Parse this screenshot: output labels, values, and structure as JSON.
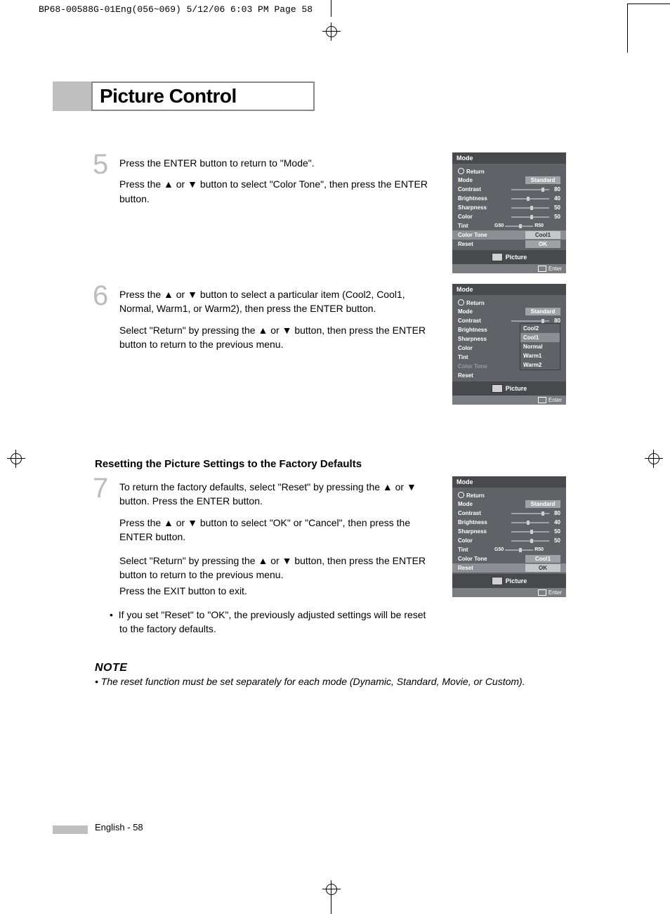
{
  "header_line": "BP68-00588G-01Eng(056~069)  5/12/06  6:03 PM  Page 58",
  "title": "Picture Control",
  "step5": {
    "num": "5",
    "p1": "Press the ENTER button to return to \"Mode\".",
    "p2": "Press the ▲ or ▼ button to select \"Color Tone\", then press the ENTER button."
  },
  "step6": {
    "num": "6",
    "p1": "Press the ▲ or ▼ button to select a particular item (Cool2, Cool1, Normal, Warm1, or Warm2), then press the ENTER button.",
    "p2": "Select \"Return\" by pressing the ▲ or ▼ button, then press the ENTER button to return to the previous menu."
  },
  "section_head": "Resetting the Picture Settings to the Factory Defaults",
  "step7": {
    "num": "7",
    "p1": "To return the factory defaults, select \"Reset\" by pressing the ▲ or ▼ button. Press the ENTER button.",
    "p2": "Press the ▲ or ▼ button to select \"OK\" or \"Cancel\", then press the ENTER button.",
    "p3": "Select \"Return\" by pressing the ▲ or ▼ button, then press the ENTER button to return to the previous menu.",
    "p4": "Press the EXIT button to exit.",
    "bullet": "If you set \"Reset\" to \"OK\", the previously adjusted settings will be reset to the factory defaults."
  },
  "note": {
    "head": "NOTE",
    "text": "•  The reset function must be set separately for each mode (Dynamic, Standard, Movie, or Custom)."
  },
  "footer": "English - 58",
  "osd": {
    "title": "Mode",
    "return": "Return",
    "mode_label": "Mode",
    "mode_val": "Standard",
    "contrast_label": "Contrast",
    "contrast_val": "80",
    "brightness_label": "Brightness",
    "brightness_val": "40",
    "sharpness_label": "Sharpness",
    "sharpness_val": "50",
    "color_label": "Color",
    "color_val": "50",
    "tint_label": "Tint",
    "tint_g": "G50",
    "tint_r": "R50",
    "colortone_label": "Color Tone",
    "colortone_val": "Cool1",
    "reset_label": "Reset",
    "reset_val": "OK",
    "footer_label": "Picture",
    "enter": "Enter"
  },
  "popup": {
    "cool2": "Cool2",
    "cool1": "Cool1",
    "normal": "Normal",
    "warm1": "Warm1",
    "warm2": "Warm2"
  }
}
